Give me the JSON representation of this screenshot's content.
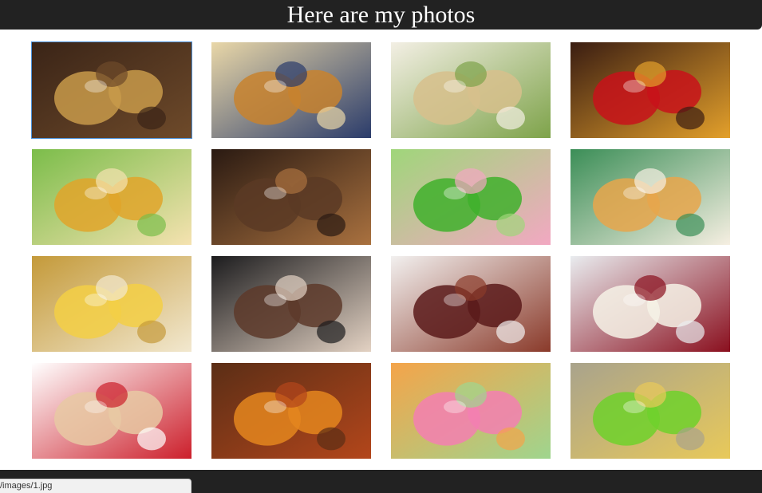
{
  "header": {
    "title": "Here are my photos"
  },
  "status_bar": {
    "url_text": "/images/1.jpg"
  },
  "photos": [
    {
      "icon": "leopard-cupcakes-photo",
      "colors": [
        "#3a2417",
        "#c89a4a",
        "#6e4a2a"
      ]
    },
    {
      "icon": "blueberry-muffins-photo",
      "colors": [
        "#e9d7a8",
        "#c8822e",
        "#2b3c6b"
      ]
    },
    {
      "icon": "kiwi-cake-slice-photo",
      "colors": [
        "#f3efe4",
        "#d7c08c",
        "#7ea34a"
      ]
    },
    {
      "icon": "festive-tea-photo",
      "colors": [
        "#3a1d12",
        "#c8121a",
        "#e3a02b"
      ]
    },
    {
      "icon": "honey-jars-photo",
      "colors": [
        "#7bbd4a",
        "#e0a52a",
        "#f5e2b0"
      ]
    },
    {
      "icon": "coffee-beans-spices-photo",
      "colors": [
        "#2a1a12",
        "#5b3a25",
        "#a9713f"
      ]
    },
    {
      "icon": "green-frosted-cupcakes-photo",
      "colors": [
        "#9fd67a",
        "#3fb02c",
        "#f2a8c2"
      ]
    },
    {
      "icon": "pancakes-stack-photo",
      "colors": [
        "#3b8e57",
        "#e7a64b",
        "#f6efe2"
      ]
    },
    {
      "icon": "cheese-platter-photo",
      "colors": [
        "#c49a3a",
        "#f3cf45",
        "#f2e8cf"
      ]
    },
    {
      "icon": "chocolate-candies-photo",
      "colors": [
        "#1c1c1e",
        "#5d3a2a",
        "#e3d2c3"
      ]
    },
    {
      "icon": "cherry-chocolate-cake-photo",
      "colors": [
        "#f2f0ef",
        "#5a1a1a",
        "#8a3a2a"
      ]
    },
    {
      "icon": "cherry-cheesecake-photo",
      "colors": [
        "#e9ecef",
        "#f6f2e6",
        "#8a0f1e"
      ]
    },
    {
      "icon": "berry-layer-cake-photo",
      "colors": [
        "#ffffff",
        "#e7c9a3",
        "#cc1f2b"
      ]
    },
    {
      "icon": "orange-tea-spices-photo",
      "colors": [
        "#5b2e16",
        "#e4861e",
        "#b3461b"
      ]
    },
    {
      "icon": "ice-cream-scoops-photo",
      "colors": [
        "#f4a44a",
        "#f37fb2",
        "#9fd58e"
      ]
    },
    {
      "icon": "green-jelly-glasses-photo",
      "colors": [
        "#a9a38c",
        "#6fd12c",
        "#e8c95a"
      ]
    }
  ]
}
